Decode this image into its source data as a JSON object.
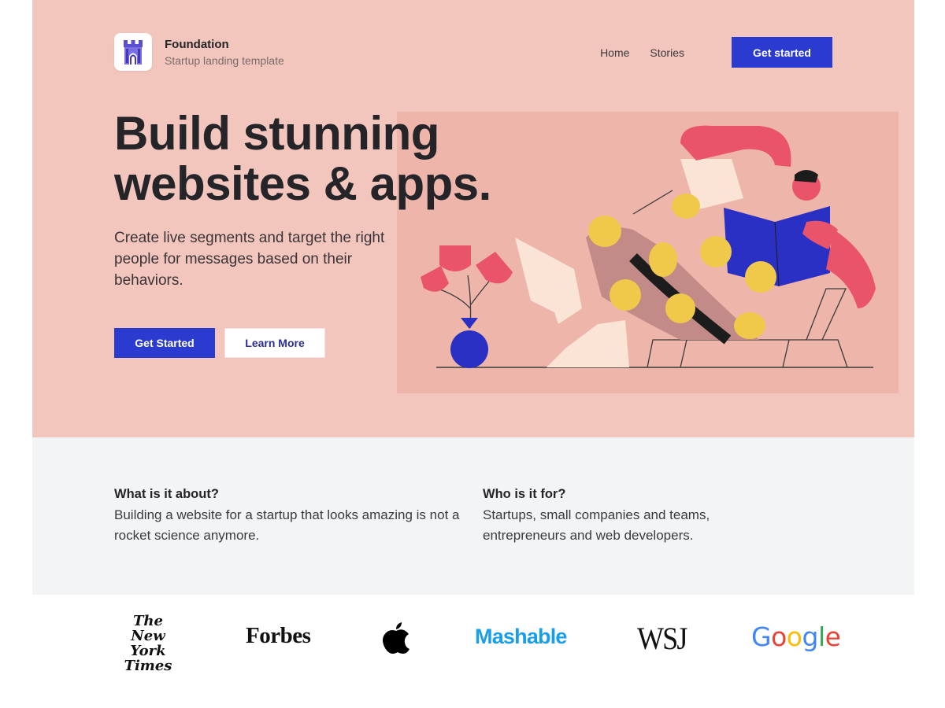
{
  "brand": {
    "name": "Foundation",
    "tagline": "Startup landing template",
    "logo_icon": "castle-tower-icon",
    "accent": "#2b3bd0"
  },
  "nav": {
    "links": [
      "Home",
      "Stories"
    ],
    "cta": "Get started"
  },
  "hero": {
    "headline_line1": "Build stunning",
    "headline_line2": "websites & apps.",
    "lead": "Create live segments and target the right people for messages based on their behaviors.",
    "primary_cta": "Get Started",
    "secondary_cta": "Learn More",
    "background": "#f2c6bd"
  },
  "features": [
    {
      "title": "What is it about?",
      "body": "Building a website for a startup that looks amazing is not a rocket science anymore."
    },
    {
      "title": "Who is it for?",
      "body": "Startups, small companies and teams, entrepreneurs and web developers."
    }
  ],
  "logos": {
    "nyt": [
      "The",
      "New York",
      "Times"
    ],
    "forbes": "Forbes",
    "apple": "apple-logo-icon",
    "mashable": "Mashable",
    "wsj": "WSJ",
    "google": [
      "G",
      "o",
      "o",
      "g",
      "l",
      "e"
    ],
    "google_colors": [
      "#4285f4",
      "#ea4335",
      "#fbbc05",
      "#4285f4",
      "#34a853",
      "#ea4335"
    ]
  }
}
